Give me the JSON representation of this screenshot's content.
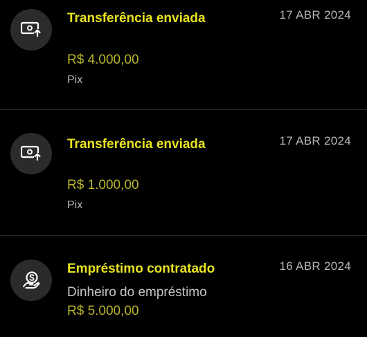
{
  "transactions": [
    {
      "icon": "money-transfer-out-icon",
      "title": "Transferência enviada",
      "date": "17 ABR 2024",
      "amount": "R$ 4.000,00",
      "method": "Pix"
    },
    {
      "icon": "money-transfer-out-icon",
      "title": "Transferência enviada",
      "date": "17 ABR 2024",
      "amount": "R$ 1.000,00",
      "method": "Pix"
    },
    {
      "icon": "loan-hand-coin-icon",
      "title": "Empréstimo contratado",
      "date": "16 ABR 2024",
      "description": "Dinheiro do empréstimo",
      "amount": "R$ 5.000,00"
    }
  ],
  "colors": {
    "background": "#000000",
    "title": "#e8e421",
    "amount": "#b9b52a",
    "secondary_text": "#b8b8b8",
    "icon_circle": "#2b2b2b",
    "divider": "#2a2a2a"
  }
}
